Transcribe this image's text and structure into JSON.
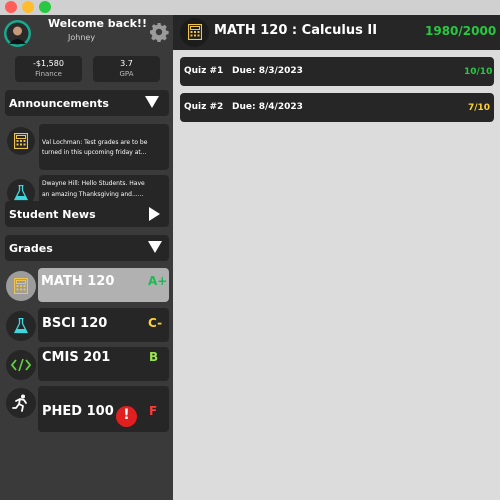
{
  "window": {
    "buttons": {
      "close_color": "#ff5f57",
      "minimize_color": "#febc2e",
      "maximize_color": "#28c840"
    }
  },
  "user": {
    "welcome": "Welcome back!!",
    "name": "Johney",
    "finance_value": "-$1,580",
    "finance_label": "Finance",
    "gpa_value": "3.7",
    "gpa_label": "GPA"
  },
  "announcements": {
    "title": "Announcements",
    "items": [
      {
        "icon": "calculator-icon",
        "line1": "Val Lochman: Test grades are to be",
        "line2": "turned in this upcoming friday at..."
      },
      {
        "icon": "flask-icon",
        "line1": "Dwayne Hill: Hello Students. Have",
        "line2": "an amazing Thanksgiving and......"
      }
    ]
  },
  "student_news": {
    "title": "Student News"
  },
  "grades": {
    "title": "Grades",
    "items": [
      {
        "course": "MATH 120",
        "grade": "A+",
        "grade_color": "#1db954",
        "icon": "calculator-icon"
      },
      {
        "course": "BSCI 120",
        "grade": "C-",
        "grade_color": "#ffd12e",
        "icon": "flask-icon"
      },
      {
        "course": "CMIS 201",
        "grade": "B",
        "grade_color": "#9be34b",
        "icon": "code-icon"
      },
      {
        "course": "PHED 100",
        "grade": "F",
        "grade_color": "#ff3b3b",
        "icon": "running-icon",
        "alert": "!"
      }
    ]
  },
  "course_header": {
    "title": "MATH 120 : Calculus II",
    "points": "1980/2000",
    "points_color": "#28c840"
  },
  "quizzes": [
    {
      "name": "Quiz #1",
      "due": "Due: 8/3/2023",
      "score": "10/10",
      "score_color": "#28c840"
    },
    {
      "name": "Quiz #2",
      "due": "Due: 8/4/2023",
      "score": "7/10",
      "score_color": "#ffd12e"
    }
  ]
}
